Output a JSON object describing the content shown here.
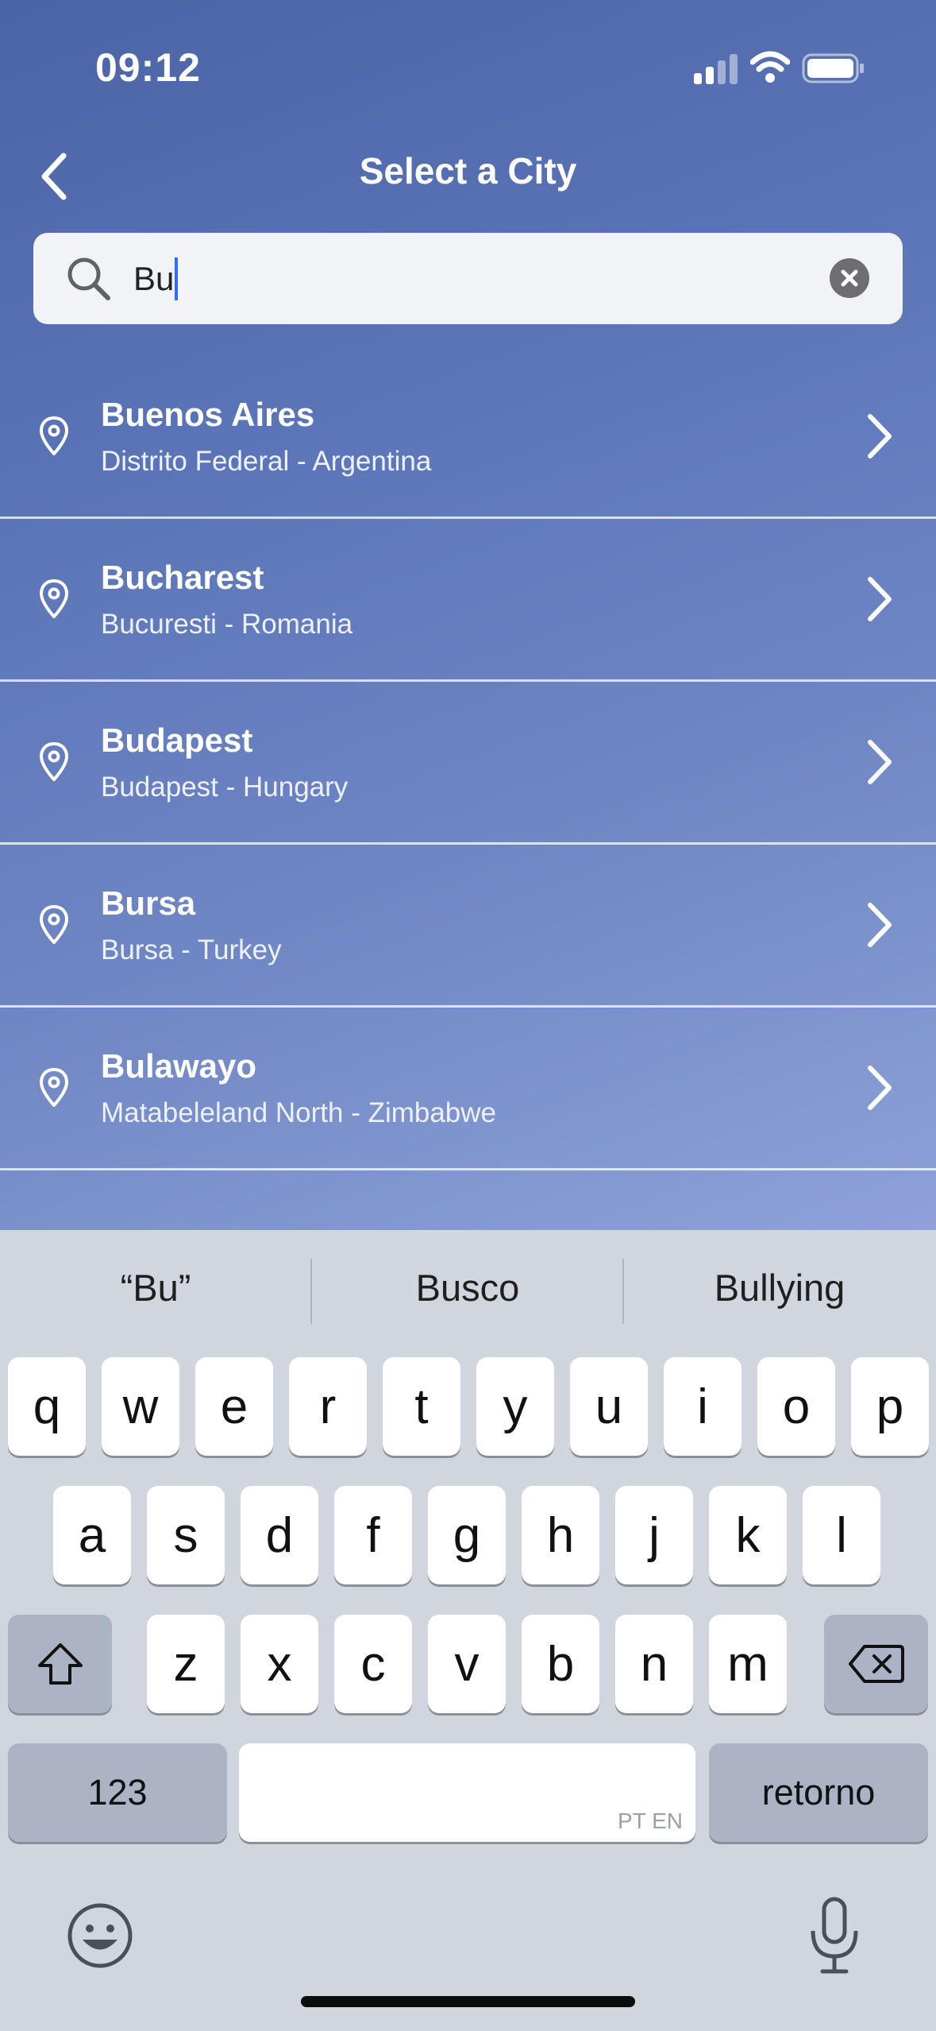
{
  "status_bar": {
    "time": "09:12"
  },
  "nav": {
    "title": "Select a City",
    "back_icon": "chevron-left-icon"
  },
  "search": {
    "value": "Bu",
    "clear_icon": "clear-x-icon"
  },
  "results": [
    {
      "city": "Buenos Aires",
      "region": "Distrito Federal - Argentina"
    },
    {
      "city": "Bucharest",
      "region": "Bucuresti - Romania"
    },
    {
      "city": "Budapest",
      "region": "Budapest - Hungary"
    },
    {
      "city": "Bursa",
      "region": "Bursa - Turkey"
    },
    {
      "city": "Bulawayo",
      "region": "Matabeleland North - Zimbabwe"
    }
  ],
  "keyboard": {
    "suggestions": [
      "“Bu”",
      "Busco",
      "Bullying"
    ],
    "row1": [
      "q",
      "w",
      "e",
      "r",
      "t",
      "y",
      "u",
      "i",
      "o",
      "p"
    ],
    "row2": [
      "a",
      "s",
      "d",
      "f",
      "g",
      "h",
      "j",
      "k",
      "l"
    ],
    "row3": [
      "z",
      "x",
      "c",
      "v",
      "b",
      "n",
      "m"
    ],
    "numbers_label": "123",
    "space_lang": "PT EN",
    "return_label": "retorno"
  },
  "colors": {
    "background_top": "#4a64a6",
    "background_bottom": "#8ea2d8",
    "keyboard_bg": "#d1d5de",
    "caret": "#2f6bff"
  }
}
